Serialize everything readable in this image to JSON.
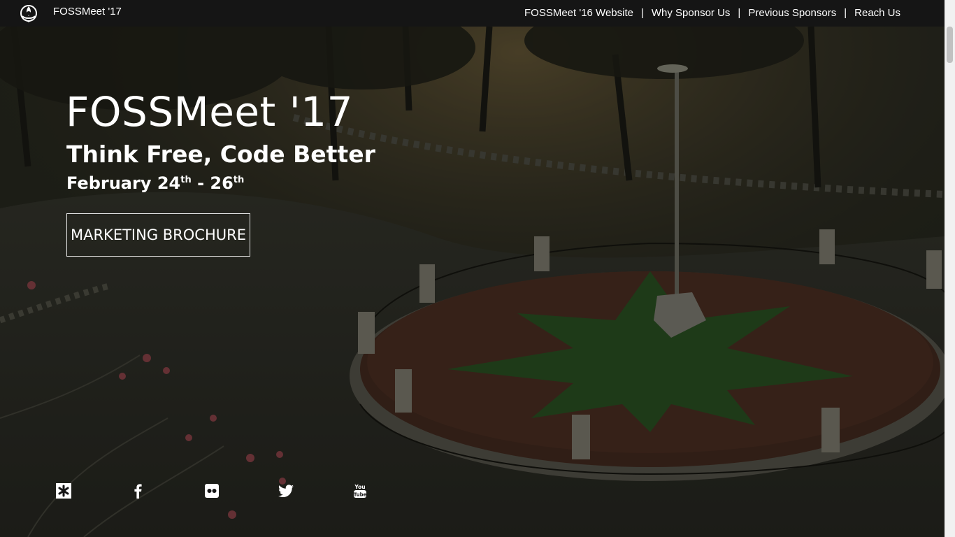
{
  "navbar": {
    "brand": "FOSSMeet '17",
    "links": [
      {
        "label": "FOSSMeet '16 Website"
      },
      {
        "label": "Why Sponsor Us"
      },
      {
        "label": "Previous Sponsors"
      },
      {
        "label": "Reach Us"
      }
    ],
    "separator": "|"
  },
  "hero": {
    "title": "FOSSMeet '17",
    "tagline": "Think Free, Code Better",
    "dates": {
      "start_month": "February 24",
      "start_suffix": "th",
      "dash": " - ",
      "end_day": "26",
      "end_suffix": "th"
    },
    "brochure_label": "MARKETING BROCHURE"
  },
  "socials": [
    {
      "name": "diaspora-icon"
    },
    {
      "name": "facebook-icon"
    },
    {
      "name": "flickr-icon"
    },
    {
      "name": "twitter-icon"
    },
    {
      "name": "youtube-icon"
    }
  ],
  "colors": {
    "navbar_bg": "#151515",
    "text": "#ffffff"
  }
}
